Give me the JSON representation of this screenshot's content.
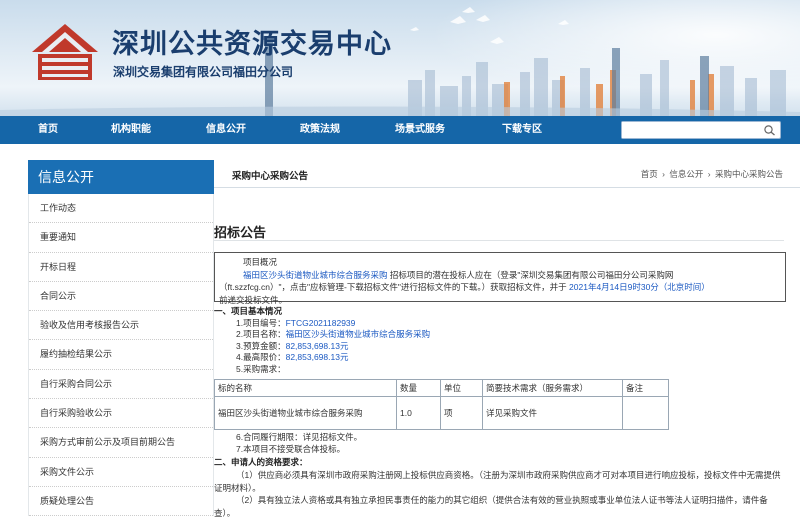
{
  "banner": {
    "title": "深圳公共资源交易中心",
    "subtitle": "深圳交易集团有限公司福田分公司"
  },
  "nav": {
    "items": [
      "首页",
      "机构职能",
      "信息公开",
      "政策法规",
      "场景式服务",
      "下载专区"
    ],
    "search_placeholder": "",
    "search_icon": "magnifier-icon"
  },
  "sidebar": {
    "title": "信息公开",
    "items": [
      "工作动态",
      "重要通知",
      "开标日程",
      "合同公示",
      "验收及信用考核报告公示",
      "履约抽检结果公示",
      "自行采购合同公示",
      "自行采购验收公示",
      "采购方式审前公示及项目前期公告",
      "采购文件公示",
      "质疑处理公告"
    ]
  },
  "content": {
    "section_title": "采购中心采购公告",
    "breadcrumb": [
      "首页",
      "信息公开",
      "采购中心采购公告"
    ],
    "breadcrumb_sep": "›",
    "notice_title": "招标公告",
    "overview": {
      "label": "项目概况",
      "project_link": "福田区沙头街道物业城市综合服务采购",
      "line1_rest": "招标项目的潜在投标人应在（登录\"深圳交易集团有限公司福田分公司采购网",
      "line2_a": "（ft.szzfcg.cn）\"，点击\"应标管理-下载招标文件\"进行招标文件的下载。）获取招标文件，并于",
      "deadline": "2021年4月14日9时30分（北京时间）",
      "line3": "前递交投标文件。"
    },
    "basic_info": {
      "heading": "一、项目基本情况",
      "code_label": "1.项目编号：",
      "code": "FTCG2021182939",
      "name_label": "2.项目名称：",
      "name": "福田区沙头街道物业城市综合服务采购",
      "budget_label": "3.预算金额：",
      "budget": "82,853,698.13元",
      "max_label": "4.最高限价：",
      "max_price": "82,853,698.13元",
      "demand_label": "5.采购需求："
    },
    "table": {
      "headers": [
        "标的名称",
        "数量",
        "单位",
        "简要技术需求（服务需求）",
        "备注"
      ],
      "row": [
        "福田区沙头街道物业城市综合服务采购",
        "1.0",
        "项",
        "详见采购文件",
        ""
      ]
    },
    "after_table": {
      "term": "6.合同履行期限：详见招标文件。",
      "consortium": "7.本项目不接受联合体投标。"
    },
    "qualification": {
      "heading": "二、申请人的资格要求：",
      "p1": "（1）供应商必须具有深圳市政府采购注册网上投标供应商资格。（注册为深圳市政府采购供应商才可对本项目进行响应投标，投标文件中无需提供证明材料）。",
      "p2": "（2）具有独立法人资格或具有独立承担民事责任的能力的其它组织（提供合法有效的营业执照或事业单位法人证书等法人证明扫描件，请件备查）。"
    }
  }
}
